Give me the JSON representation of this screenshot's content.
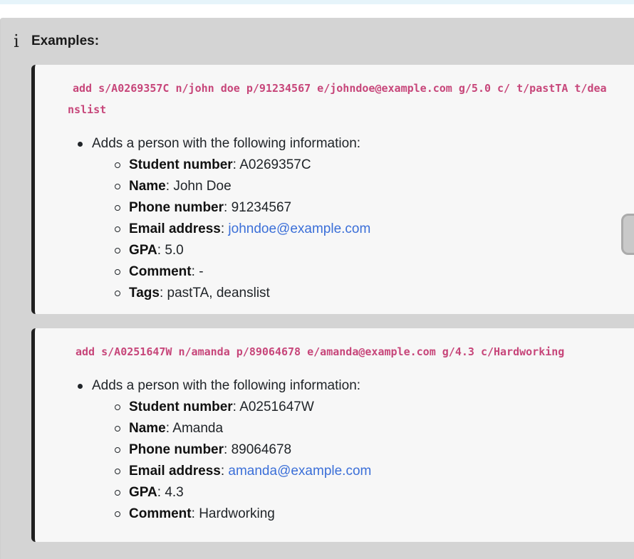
{
  "callout": {
    "icon": "info-icon",
    "title": "Examples:"
  },
  "examples": [
    {
      "command": "add s/A0269357C n/john doe p/91234567 e/johndoe@example.com g/5.0 c/ t/pastTA t/deanslist",
      "intro": "Adds a person with the following information:",
      "fields": {
        "student_number": {
          "label": "Student number",
          "value": "A0269357C"
        },
        "name": {
          "label": "Name",
          "value": "John Doe"
        },
        "phone": {
          "label": "Phone number",
          "value": "91234567"
        },
        "email": {
          "label": "Email address",
          "value": "johndoe@example.com"
        },
        "gpa": {
          "label": "GPA",
          "value": "5.0"
        },
        "comment": {
          "label": "Comment",
          "value": "-"
        },
        "tags": {
          "label": "Tags",
          "value": "pastTA, deanslist"
        }
      }
    },
    {
      "command": "add s/A0251647W n/amanda p/89064678 e/amanda@example.com g/4.3 c/Hardworking",
      "intro": "Adds a person with the following information:",
      "fields": {
        "student_number": {
          "label": "Student number",
          "value": "A0251647W"
        },
        "name": {
          "label": "Name",
          "value": "Amanda"
        },
        "phone": {
          "label": "Phone number",
          "value": "89064678"
        },
        "email": {
          "label": "Email address",
          "value": "amanda@example.com"
        },
        "gpa": {
          "label": "GPA",
          "value": "4.3"
        },
        "comment": {
          "label": "Comment",
          "value": "Hardworking"
        }
      }
    }
  ],
  "colors": {
    "command_text": "#c7467a",
    "link": "#3b6fd8",
    "callout_bg": "#d4d4d4",
    "card_bg": "#f7f7f7",
    "card_border": "#1f1f1f"
  }
}
